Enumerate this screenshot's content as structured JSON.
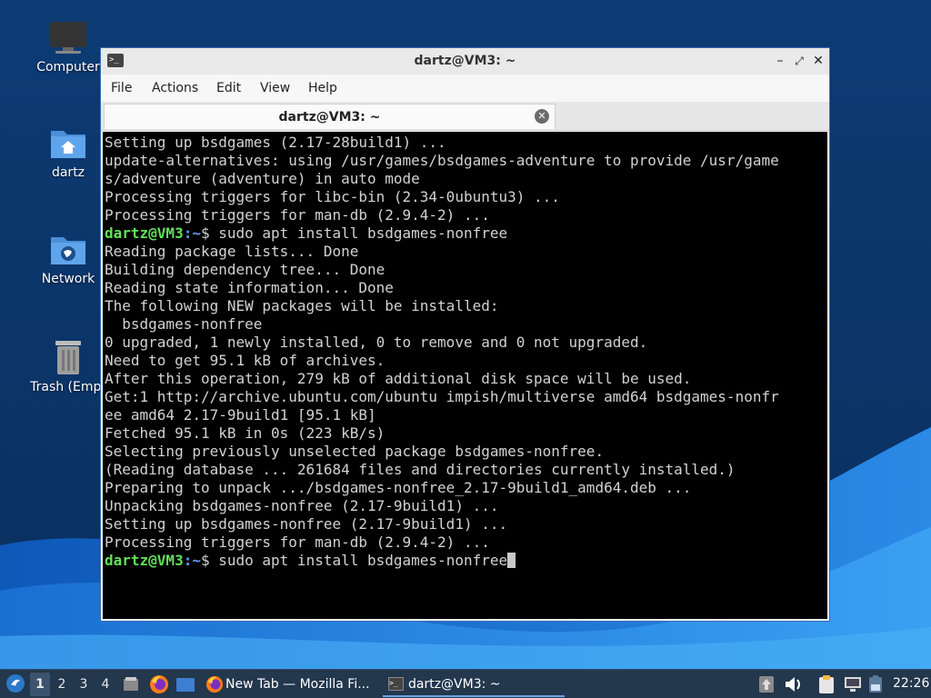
{
  "desktop": {
    "icons": [
      {
        "label": "Computer",
        "icon": "computer-icon"
      },
      {
        "label": "dartz",
        "icon": "home-folder-icon"
      },
      {
        "label": "Network",
        "icon": "network-folder-icon"
      },
      {
        "label": "Trash (Empt",
        "icon": "trash-icon"
      }
    ],
    "colors": {
      "accent": "#3b6fb6",
      "prompt_user": "#63e05a",
      "prompt_path": "#5c9cff"
    }
  },
  "window": {
    "title": "dartz@VM3: ~",
    "menu": [
      "File",
      "Actions",
      "Edit",
      "View",
      "Help"
    ],
    "tab_label": "dartz@VM3: ~"
  },
  "terminal": {
    "prompt_user": "dartz@VM3",
    "prompt_path": ":~",
    "prompt_symbol": "$ ",
    "lines": [
      "Setting up bsdgames (2.17-28build1) ...",
      "update-alternatives: using /usr/games/bsdgames-adventure to provide /usr/game",
      "s/adventure (adventure) in auto mode",
      "Processing triggers for libc-bin (2.34-0ubuntu3) ...",
      "Processing triggers for man-db (2.9.4-2) ...",
      "sudo apt install bsdgames-nonfree",
      "Reading package lists... Done",
      "Building dependency tree... Done",
      "Reading state information... Done",
      "The following NEW packages will be installed:",
      "  bsdgames-nonfree",
      "0 upgraded, 1 newly installed, 0 to remove and 0 not upgraded.",
      "Need to get 95.1 kB of archives.",
      "After this operation, 279 kB of additional disk space will be used.",
      "Get:1 http://archive.ubuntu.com/ubuntu impish/multiverse amd64 bsdgames-nonfr",
      "ee amd64 2.17-9build1 [95.1 kB]",
      "Fetched 95.1 kB in 0s (223 kB/s)",
      "Selecting previously unselected package bsdgames-nonfree.",
      "(Reading database ... 261684 files and directories currently installed.)",
      "Preparing to unpack .../bsdgames-nonfree_2.17-9build1_amd64.deb ...",
      "Unpacking bsdgames-nonfree (2.17-9build1) ...",
      "Setting up bsdgames-nonfree (2.17-9build1) ...",
      "Processing triggers for man-db (2.9.4-2) ...",
      "sudo apt install bsdgames-nonfree"
    ]
  },
  "taskbar": {
    "workspaces": [
      "1",
      "2",
      "3",
      "4"
    ],
    "tasks": [
      {
        "label": "New Tab — Mozilla Fi...",
        "icon": "firefox-icon"
      },
      {
        "label": "dartz@VM3: ~",
        "icon": "terminal-icon"
      }
    ],
    "clock": "22:26"
  }
}
